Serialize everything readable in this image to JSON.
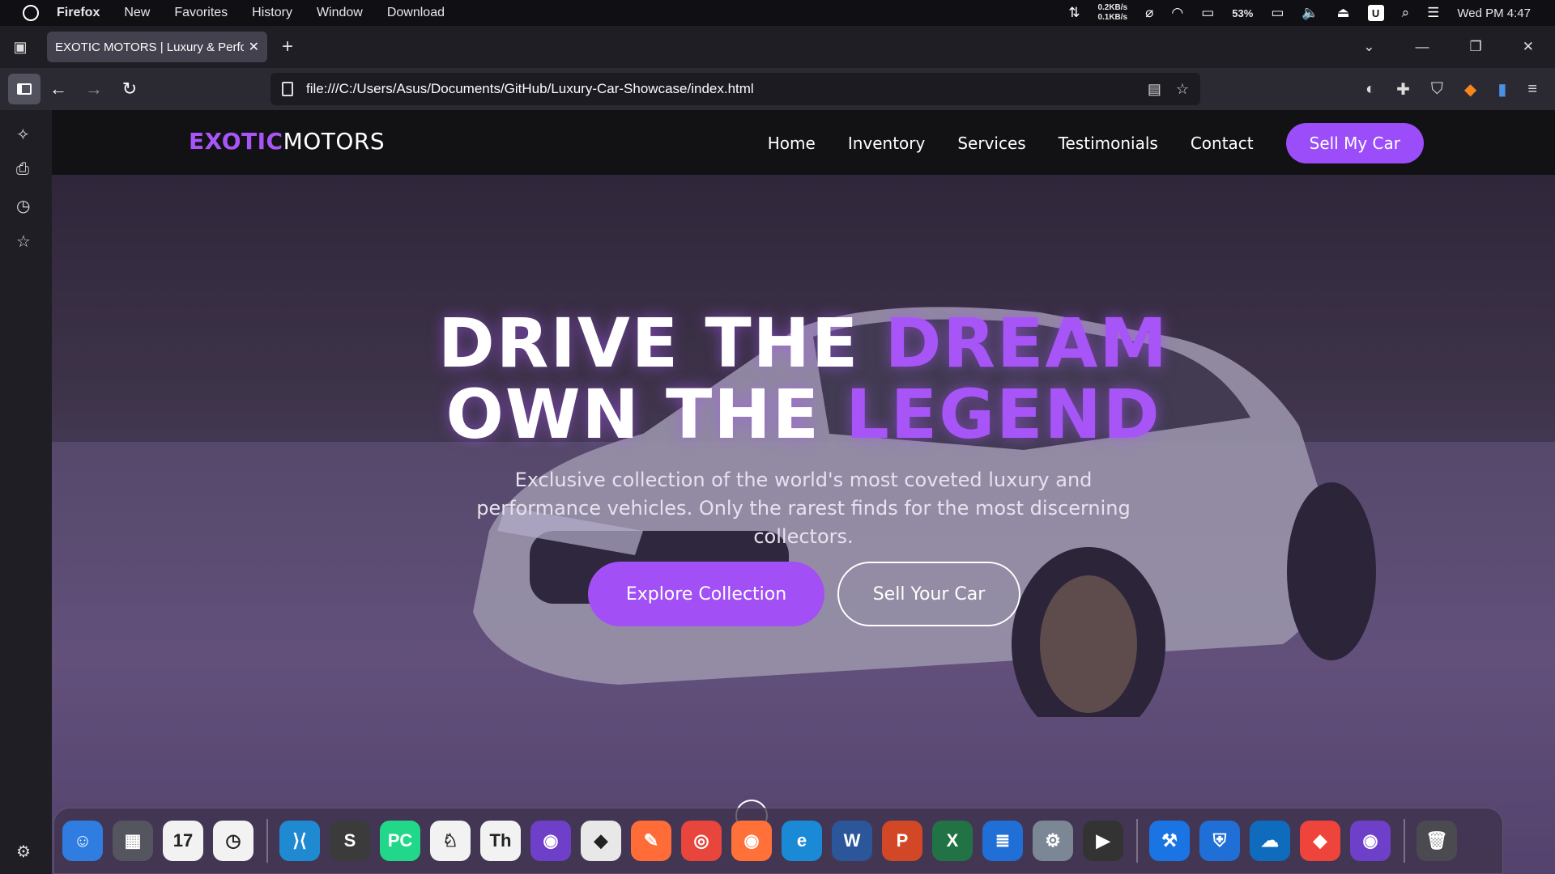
{
  "menubar": {
    "app_name": "Firefox",
    "items": [
      "New",
      "Favorites",
      "History",
      "Window",
      "Download"
    ],
    "net_up": "0.2KB/s",
    "net_down": "0.1KB/s",
    "battery": "53%",
    "clock": "Wed PM 4:47",
    "u_badge": "U"
  },
  "tab": {
    "title": "EXOTIC MOTORS | Luxury & Perform"
  },
  "urlbar": {
    "url": "file:///C:/Users/Asus/Documents/GitHub/Luxury-Car-Showcase/index.html"
  },
  "site": {
    "logo_part1": "EXOTIC",
    "logo_part2": "MOTORS",
    "nav": [
      "Home",
      "Inventory",
      "Services",
      "Testimonials",
      "Contact"
    ],
    "cta": "Sell My Car",
    "accent": "#a855f7",
    "hero": {
      "line1_white": "DRIVE THE ",
      "line1_purple": "DREAM",
      "line2_white": "OWN THE ",
      "line2_purple": "LEGEND",
      "subtitle": "Exclusive collection of the world's most coveted luxury and performance vehicles. Only the rarest finds for the most discerning collectors.",
      "primary_button": "Explore Collection",
      "secondary_button": "Sell Your Car"
    }
  },
  "dock": {
    "apps": [
      {
        "name": "finder",
        "glyph": "☺",
        "color": "#2f7de1"
      },
      {
        "name": "launchpad",
        "glyph": "▦",
        "color": "#555560"
      },
      {
        "name": "calendar",
        "glyph": "17",
        "color": "#f2f2f2"
      },
      {
        "name": "clock",
        "glyph": "◷",
        "color": "#f2f2f2"
      },
      {
        "name": "vscode",
        "glyph": "⟩⟨",
        "color": "#1f8ad2"
      },
      {
        "name": "sublime",
        "glyph": "S",
        "color": "#3b3b3b"
      },
      {
        "name": "pycharm",
        "glyph": "PC",
        "color": "#21d789"
      },
      {
        "name": "rabbit",
        "glyph": "♘",
        "color": "#f2f2f2"
      },
      {
        "name": "typora",
        "glyph": "Th",
        "color": "#f2f2f2"
      },
      {
        "name": "github-desktop",
        "glyph": "◉",
        "color": "#6e40c9"
      },
      {
        "name": "git",
        "glyph": "◆",
        "color": "#e8e8e8"
      },
      {
        "name": "postman",
        "glyph": "✎",
        "color": "#ff6c37"
      },
      {
        "name": "chrome",
        "glyph": "◎",
        "color": "#e8453c"
      },
      {
        "name": "firefox",
        "glyph": "◉",
        "color": "#ff7139"
      },
      {
        "name": "edge",
        "glyph": "e",
        "color": "#1b8ad6"
      },
      {
        "name": "word",
        "glyph": "W",
        "color": "#2b579a"
      },
      {
        "name": "powerpoint",
        "glyph": "P",
        "color": "#d24726"
      },
      {
        "name": "excel",
        "glyph": "X",
        "color": "#217346"
      },
      {
        "name": "notes",
        "glyph": "≣",
        "color": "#1f6fd6"
      },
      {
        "name": "settings",
        "glyph": "⚙",
        "color": "#7c8796"
      },
      {
        "name": "player",
        "glyph": "▶",
        "color": "#333333"
      },
      {
        "name": "xcode",
        "glyph": "⚒",
        "color": "#1b74e4"
      },
      {
        "name": "defender",
        "glyph": "⛨",
        "color": "#1f6fd6"
      },
      {
        "name": "onedrive",
        "glyph": "☁",
        "color": "#0f6cbd"
      },
      {
        "name": "anydesk",
        "glyph": "◆",
        "color": "#ef443b"
      },
      {
        "name": "github",
        "glyph": "◉",
        "color": "#6e40c9"
      },
      {
        "name": "trash",
        "glyph": "🗑",
        "color": "#4a4a50"
      }
    ]
  }
}
